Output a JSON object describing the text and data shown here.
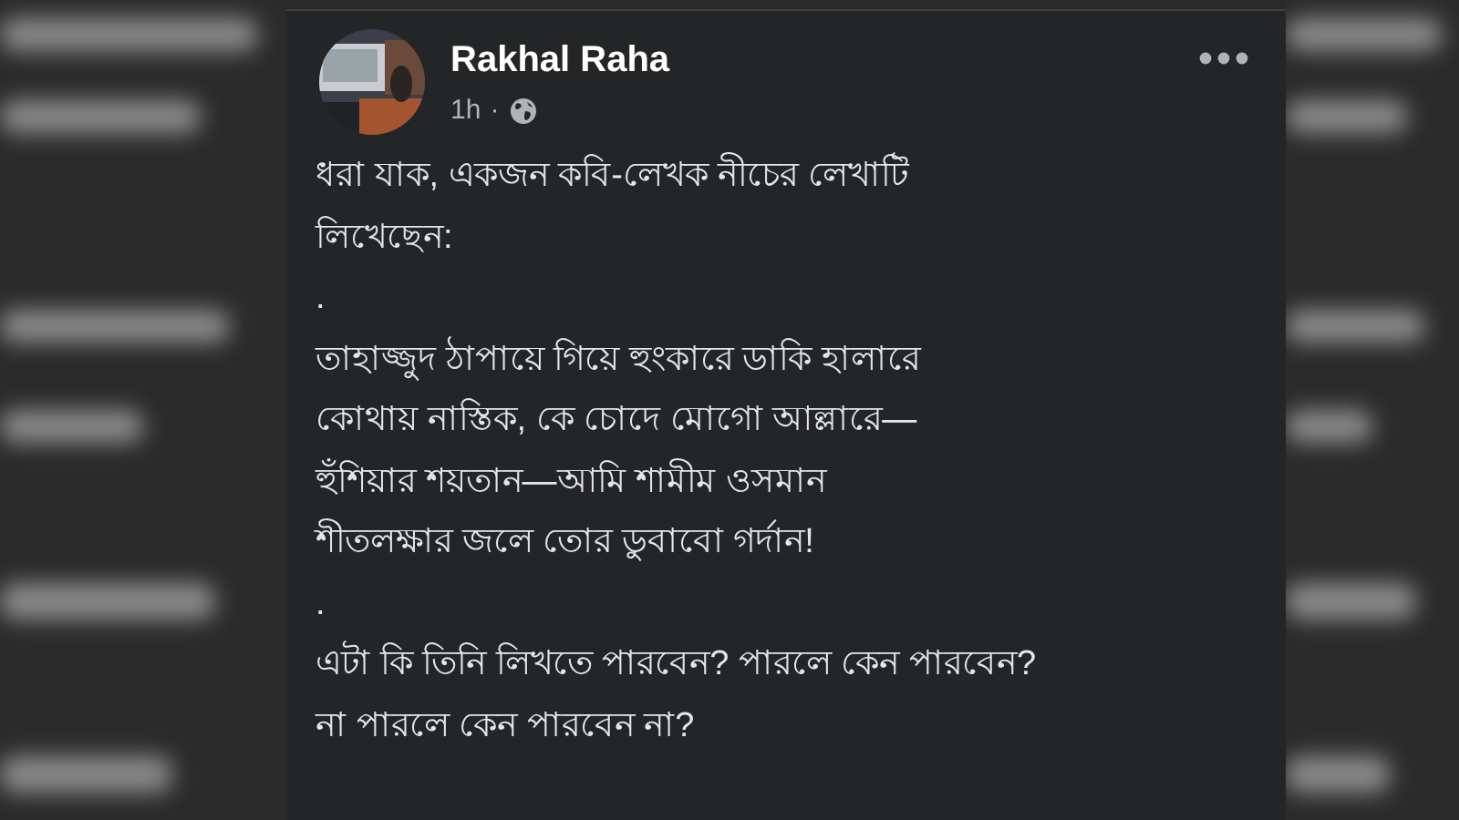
{
  "post": {
    "author": "Rakhal Raha",
    "time": "1h",
    "separator": "·",
    "lines": [
      "ধরা যাক, একজন কবি-লেখক নীচের লেখাটি",
      "লিখেছেন:",
      ".",
      "তাহাজ্জুদ ঠাপায়ে গিয়ে হুংকারে ডাকি হালারে",
      "কোথায় নাস্তিক, কে চোদে মোগো আল্লারে—",
      "হুঁশিয়ার শয়তান—আমি শামীম ওসমান",
      "শীতলক্ষার জলে তোর ডুবাবো গর্দান!",
      ".",
      "এটা কি তিনি লিখতে পারবেন? পারলে কেন পারবেন?",
      "না পারলে কেন পারবেন না?"
    ]
  }
}
